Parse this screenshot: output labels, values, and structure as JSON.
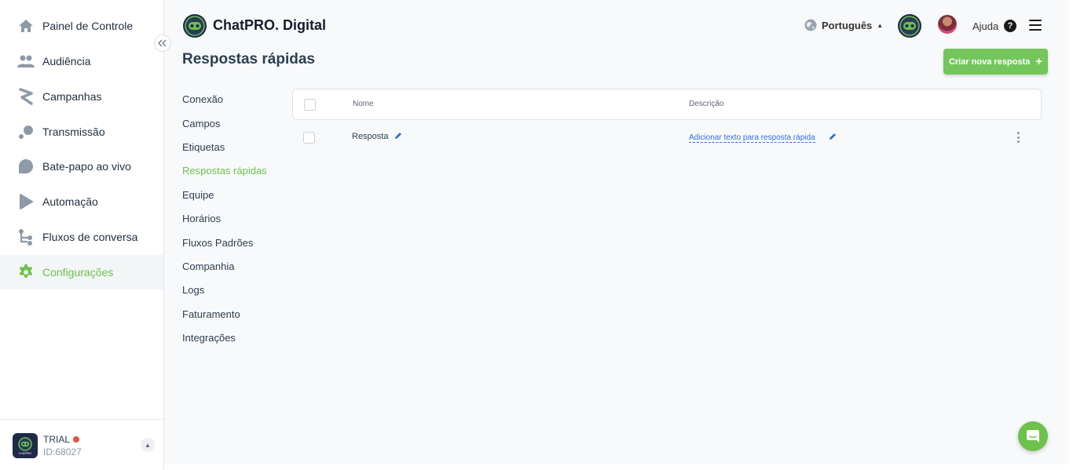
{
  "sidebar": {
    "items": [
      {
        "label": "Painel de Controle",
        "icon": "home-icon"
      },
      {
        "label": "Audiência",
        "icon": "users-icon"
      },
      {
        "label": "Campanhas",
        "icon": "campaign-icon"
      },
      {
        "label": "Transmissão",
        "icon": "broadcast-icon"
      },
      {
        "label": "Bate-papo ao vivo",
        "icon": "chat-icon"
      },
      {
        "label": "Automação",
        "icon": "automation-icon"
      },
      {
        "label": "Fluxos de conversa",
        "icon": "flow-icon"
      },
      {
        "label": "Configurações",
        "icon": "gear-icon",
        "active": true
      }
    ],
    "account": {
      "plan": "TRIAL",
      "id": "ID:68027",
      "logo_text": "CHATPRO"
    }
  },
  "header": {
    "brand": "ChatPRO. Digital",
    "language": "Português",
    "help": "Ajuda"
  },
  "page": {
    "title": "Respostas rápidas",
    "create_button": "Criar nova resposta"
  },
  "settings_menu": [
    {
      "label": "Conexão"
    },
    {
      "label": "Campos"
    },
    {
      "label": "Etiquetas"
    },
    {
      "label": "Respostas rápidas",
      "active": true
    },
    {
      "label": "Equipe"
    },
    {
      "label": "Horários"
    },
    {
      "label": "Fluxos Padrões"
    },
    {
      "label": "Companhia"
    },
    {
      "label": "Logs"
    },
    {
      "label": "Faturamento"
    },
    {
      "label": "Integrações"
    }
  ],
  "table": {
    "columns": [
      "Nome",
      "Descrição"
    ],
    "rows": [
      {
        "name": "Resposta",
        "description": "Adicionar texto para resposta rápida"
      }
    ]
  },
  "colors": {
    "accent": "#6cc24a",
    "link": "#2f6fd6",
    "status_dot": "#e0533d"
  }
}
